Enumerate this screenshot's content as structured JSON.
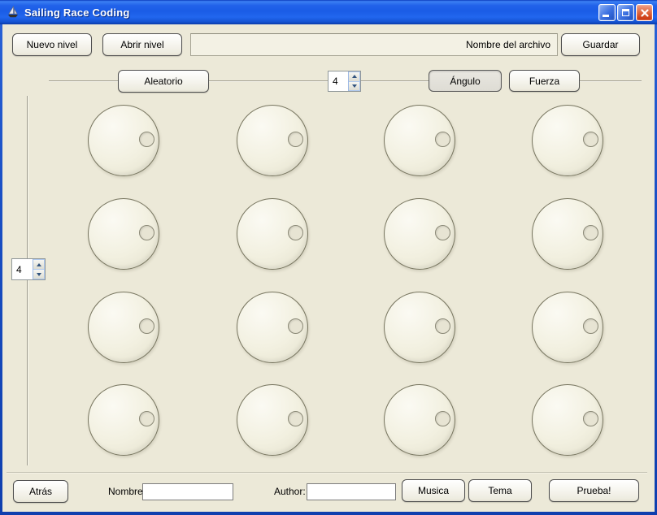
{
  "window": {
    "title": "Sailing Race Coding"
  },
  "toolbar_top": {
    "new_level_label": "Nuevo nivel",
    "open_level_label": "Abrir nivel",
    "filename_label": "Nombre del archivo",
    "filename_value": "",
    "save_label": "Guardar"
  },
  "row_controls": {
    "random_label": "Aleatorio",
    "columns_spinner_value": "4",
    "angle_label": "Ángulo",
    "force_label": "Fuerza"
  },
  "left_rail": {
    "rows_spinner_value": "4"
  },
  "grid": {
    "rows": 4,
    "cols": 4
  },
  "bottom_bar": {
    "back_label": "Atrás",
    "name_label": "Nombre:",
    "name_value": "",
    "author_label": "Author:",
    "author_value": "",
    "music_label": "Musica",
    "theme_label": "Tema",
    "test_label": "Prueba!"
  },
  "colors": {
    "titlebar_blue": "#1b5ce8",
    "client_background": "#ece9d8",
    "close_button_red": "#cc3a12"
  }
}
